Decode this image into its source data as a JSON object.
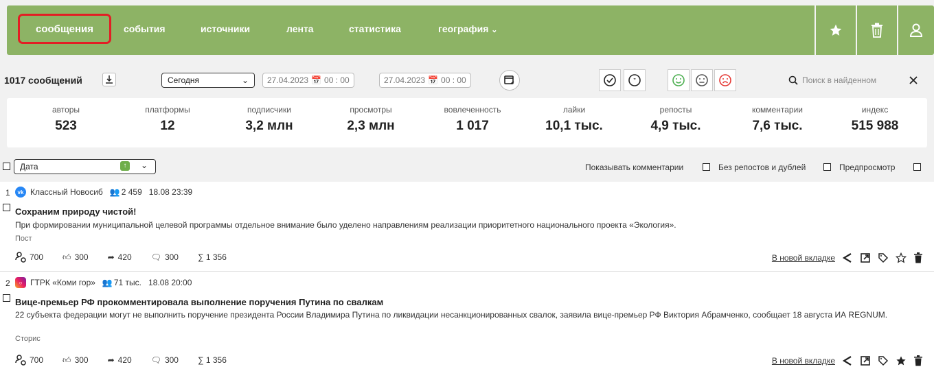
{
  "nav": {
    "tabs": [
      "сообщения",
      "события",
      "источники",
      "лента",
      "статистика",
      "география"
    ],
    "active_index": 0,
    "icons": [
      "star-icon",
      "trash-icon",
      "user-icon"
    ],
    "accent_color": "#8db365",
    "active_border_color": "#e31e24"
  },
  "toolbar": {
    "count_label": "1017 сообщений",
    "period_value": "Сегодня",
    "date_from": "27.04.2023",
    "time_from": "00 : 00",
    "date_to": "27.04.2023",
    "time_to": "00 : 00",
    "search_placeholder": "Поиск в найденном"
  },
  "stats": [
    {
      "label": "авторы",
      "value": "523"
    },
    {
      "label": "платформы",
      "value": "12"
    },
    {
      "label": "подписчики",
      "value": "3,2 млн"
    },
    {
      "label": "просмотры",
      "value": "2,3 млн"
    },
    {
      "label": "вовлеченность",
      "value": "1 017"
    },
    {
      "label": "лайки",
      "value": "10,1 тыс."
    },
    {
      "label": "репосты",
      "value": "4,9 тыс."
    },
    {
      "label": "комментарии",
      "value": "7,6 тыс."
    },
    {
      "label": "индекс",
      "value": "515 988"
    }
  ],
  "filters": {
    "sort_value": "Дата",
    "show_comments": "Показывать комментарии",
    "no_reposts": "Без репостов и дублей",
    "preview": "Предпросмотр"
  },
  "posts": [
    {
      "num": "1",
      "platform_icon": "vk-icon",
      "source": "Классный Новосиб",
      "audience": "2 459",
      "datetime": "18.08 23:39",
      "title": "Сохраним природу чистой!",
      "text": "При формировании муниципальной целевой программы отдельное внимание было уделено направлениям реализации приоритетного национального проекта «Экология».",
      "type": "Пост",
      "reach": "700",
      "likes": "300",
      "reposts": "420",
      "comments": "300",
      "sum": "∑ 1 356",
      "open_link": "В новой вкладке",
      "favorite": false
    },
    {
      "num": "2",
      "platform_icon": "instagram-icon",
      "source": "ГТРК «Коми гор»",
      "audience": "71 тыс.",
      "datetime": "18.08 20:00",
      "title": "Вице-премьер РФ прокомментировала выполнение поручения Путина по свалкам",
      "text": "22 субъекта федерации могут не выполнить поручение президента России Владимира Путина по ликвидации несанкционированных свалок, заявила вице-премьер РФ Виктория Абрамченко, сообщает 18 августа ИА REGNUM.",
      "type": "Сторис",
      "reach": "700",
      "likes": "300",
      "reposts": "420",
      "comments": "300",
      "sum": "∑ 1 356",
      "open_link": "В новой вкладке",
      "favorite": true
    }
  ]
}
